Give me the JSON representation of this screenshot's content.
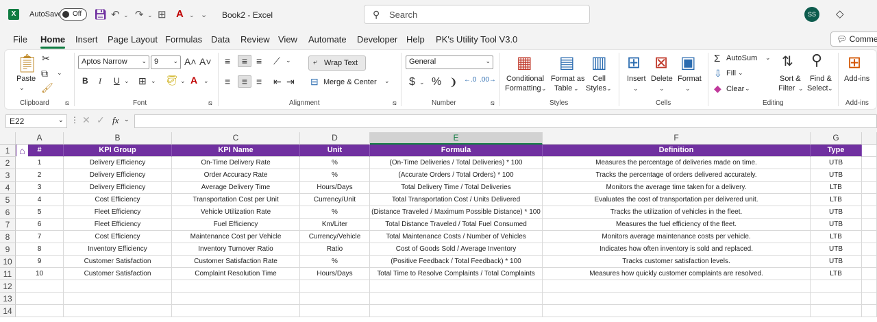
{
  "titlebar": {
    "autosave_label": "AutoSave",
    "autosave_state": "Off",
    "document_title": "Book2  -  Excel",
    "search_placeholder": "Search",
    "user_initials": "SS"
  },
  "tabs": [
    "File",
    "Home",
    "Insert",
    "Page Layout",
    "Formulas",
    "Data",
    "Review",
    "View",
    "Automate",
    "Developer",
    "Help",
    "PK's Utility Tool V3.0"
  ],
  "active_tab": "Home",
  "comments_label": "Commen",
  "ribbon": {
    "clipboard": {
      "paste": "Paste",
      "label": "Clipboard"
    },
    "font": {
      "name": "Aptos Narrow",
      "size": "9",
      "bold": "B",
      "italic": "I",
      "underline": "U",
      "label": "Font"
    },
    "alignment": {
      "wrap_text": "Wrap Text",
      "merge_center": "Merge & Center",
      "label": "Alignment"
    },
    "number": {
      "format": "General",
      "currency": "$",
      "percent": "%",
      "comma": "❩",
      "label": "Number"
    },
    "styles": {
      "conditional_1": "Conditional",
      "conditional_2": "Formatting",
      "table_1": "Format as",
      "table_2": "Table",
      "cell_1": "Cell",
      "cell_2": "Styles",
      "label": "Styles"
    },
    "cells": {
      "insert": "Insert",
      "delete": "Delete",
      "format": "Format",
      "label": "Cells"
    },
    "editing": {
      "autosum": "AutoSum",
      "fill": "Fill",
      "clear": "Clear",
      "sort_1": "Sort &",
      "sort_2": "Filter",
      "find_1": "Find &",
      "find_2": "Select",
      "label": "Editing"
    },
    "addins": {
      "addins": "Add-ins",
      "label": "Add-ins"
    }
  },
  "formula_bar": {
    "name_box": "E22",
    "fx": "fx",
    "content": ""
  },
  "columns": [
    "A",
    "B",
    "C",
    "D",
    "E",
    "F",
    "G"
  ],
  "selected_column": "E",
  "row_numbers": [
    "1",
    "2",
    "3",
    "4",
    "5",
    "6",
    "7",
    "8",
    "9",
    "10",
    "11",
    "12",
    "13",
    "14"
  ],
  "table": {
    "headers": [
      "#",
      "KPI Group",
      "KPI Name",
      "Unit",
      "Formula",
      "Definition",
      "Type"
    ],
    "rows": [
      [
        "1",
        "Delivery Efficiency",
        "On-Time Delivery Rate",
        "%",
        "(On-Time Deliveries / Total Deliveries) * 100",
        "Measures the percentage of deliveries made on time.",
        "UTB"
      ],
      [
        "2",
        "Delivery Efficiency",
        "Order Accuracy Rate",
        "%",
        "(Accurate Orders / Total Orders) * 100",
        "Tracks the percentage of orders delivered accurately.",
        "UTB"
      ],
      [
        "3",
        "Delivery Efficiency",
        "Average Delivery Time",
        "Hours/Days",
        "Total Delivery Time / Total Deliveries",
        "Monitors the average time taken for a delivery.",
        "LTB"
      ],
      [
        "4",
        "Cost Efficiency",
        "Transportation Cost per Unit",
        "Currency/Unit",
        "Total Transportation Cost / Units Delivered",
        "Evaluates the cost of transportation per delivered unit.",
        "LTB"
      ],
      [
        "5",
        "Fleet Efficiency",
        "Vehicle Utilization Rate",
        "%",
        "(Distance Traveled / Maximum Possible Distance) * 100",
        "Tracks the utilization of vehicles in the fleet.",
        "UTB"
      ],
      [
        "6",
        "Fleet Efficiency",
        "Fuel Efficiency",
        "Km/Liter",
        "Total Distance Traveled / Total Fuel Consumed",
        "Measures the fuel efficiency of the fleet.",
        "UTB"
      ],
      [
        "7",
        "Cost Efficiency",
        "Maintenance Cost per Vehicle",
        "Currency/Vehicle",
        "Total Maintenance Costs / Number of Vehicles",
        "Monitors average maintenance costs per vehicle.",
        "LTB"
      ],
      [
        "8",
        "Inventory Efficiency",
        "Inventory Turnover Ratio",
        "Ratio",
        "Cost of Goods Sold / Average Inventory",
        "Indicates how often inventory is sold and replaced.",
        "UTB"
      ],
      [
        "9",
        "Customer Satisfaction",
        "Customer Satisfaction Rate",
        "%",
        "(Positive Feedback / Total Feedback) * 100",
        "Tracks customer satisfaction levels.",
        "UTB"
      ],
      [
        "10",
        "Customer Satisfaction",
        "Complaint Resolution Time",
        "Hours/Days",
        "Total Time to Resolve Complaints / Total Complaints",
        "Measures how quickly customer complaints are resolved.",
        "LTB"
      ]
    ]
  },
  "colors": {
    "header_bg": "#7030a0",
    "accent": "#107c41"
  }
}
